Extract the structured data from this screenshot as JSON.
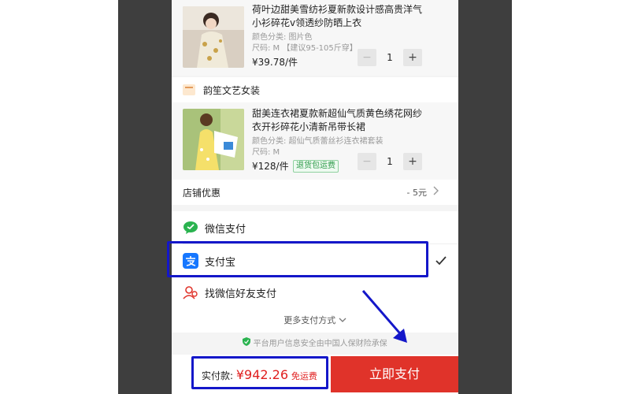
{
  "items": [
    {
      "title": "荷叶边甜美雪纺衫夏新款设计感高贵洋气小衫碎花v领透纱防晒上衣",
      "color": "颜色分类: 图片色",
      "size": "尺码: M 【建议95-105斤穿】",
      "price": "¥39.78/件",
      "qty": "1",
      "minus": "−",
      "plus": "+"
    },
    {
      "title": "甜美连衣裙夏款新超仙气质黄色绣花网纱衣开衫碎花小清新吊带长裙",
      "color": "颜色分类: 超仙气质蕾丝衫连衣裙套装",
      "size": "尺码: M",
      "price": "¥128/件",
      "badge": "退货包运费",
      "qty": "1",
      "minus": "−",
      "plus": "+"
    }
  ],
  "shop": {
    "name": "韵笙文艺女装"
  },
  "coupon": {
    "label": "店铺优惠",
    "value": "- 5元"
  },
  "payment": {
    "options": [
      {
        "label": "微信支付"
      },
      {
        "label": "支付宝"
      },
      {
        "label": "找微信好友支付"
      }
    ],
    "more": "更多支付方式",
    "secure": "平台用户信息安全由中国人保财险承保"
  },
  "footer": {
    "total_label": "实付款: ",
    "total_amount": "¥942.26",
    "shipping": "免运费",
    "pay_button": "立即支付"
  },
  "colors": {
    "accent": "#e0332a",
    "highlight": "#1417c9",
    "wechat": "#2ab34f",
    "alipay": "#1677ff"
  }
}
